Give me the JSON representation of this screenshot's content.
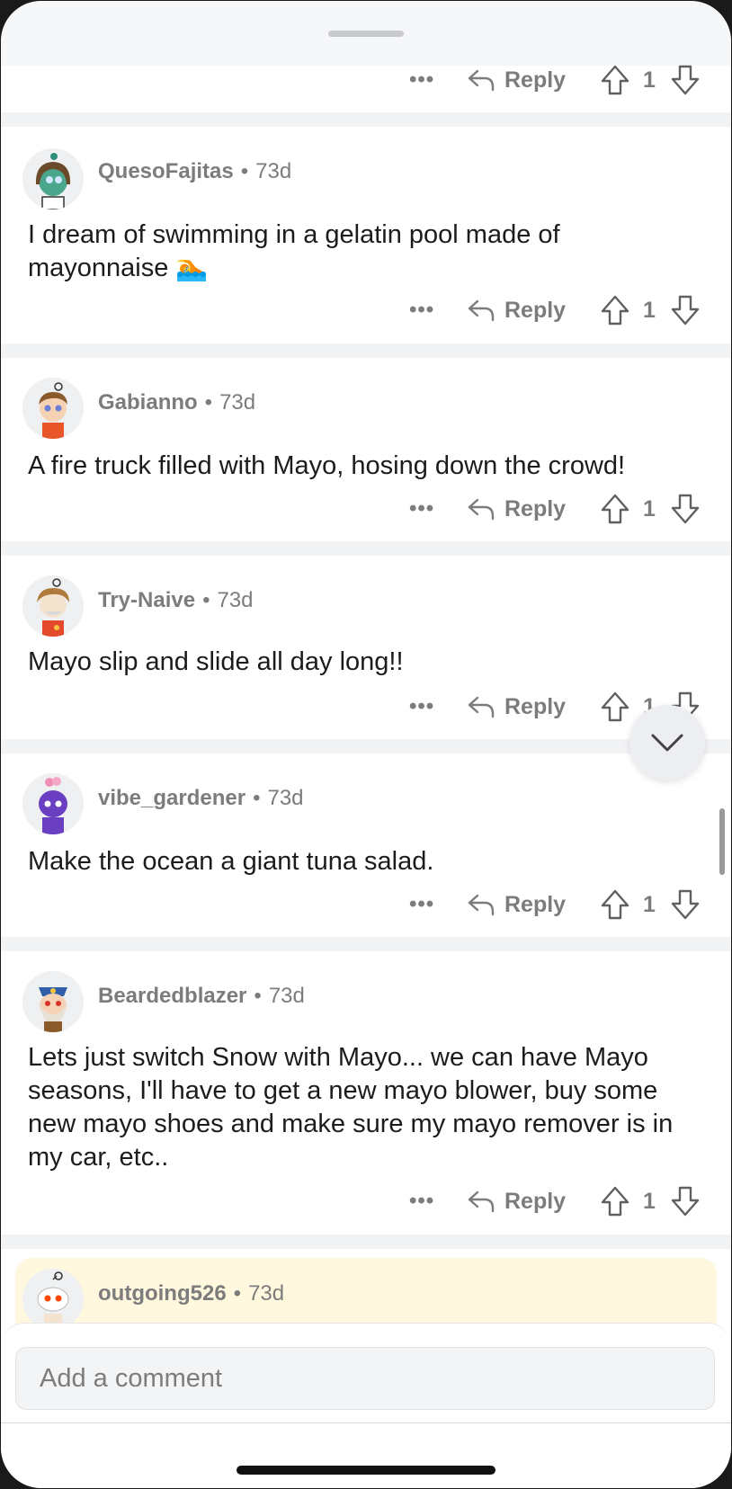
{
  "comments_top": {
    "more_label": "•••",
    "reply_label": "Reply",
    "score": "1"
  },
  "comments": [
    {
      "author": "QuesoFajitas",
      "age": "73d",
      "text": "I dream of swimming in a gelatin pool made of mayonnaise 🏊",
      "more_label": "•••",
      "reply_label": "Reply",
      "score": "1"
    },
    {
      "author": "Gabianno",
      "age": "73d",
      "text": "A fire truck filled with Mayo, hosing down the crowd!",
      "more_label": "•••",
      "reply_label": "Reply",
      "score": "1"
    },
    {
      "author": "Try-Naive",
      "age": "73d",
      "text": "Mayo slip and slide all day long!!",
      "more_label": "•••",
      "reply_label": "Reply",
      "score": "1"
    },
    {
      "author": "vibe_gardener",
      "age": "73d",
      "text": "Make the ocean a giant tuna salad.",
      "more_label": "•••",
      "reply_label": "Reply",
      "score": "1"
    },
    {
      "author": "Beardedblazer",
      "age": "73d",
      "text": "Lets just switch Snow with Mayo... we can have Mayo seasons, I'll have to get a new mayo blower, buy some new mayo shoes and make sure my mayo remover is in my car, etc..",
      "more_label": "•••",
      "reply_label": "Reply",
      "score": "1"
    },
    {
      "author": "outgoing526",
      "age": "73d"
    }
  ],
  "composer": {
    "placeholder": "Add a comment"
  },
  "colors": {
    "highlight": "#fff8df",
    "meta_gray": "#7c7c7c",
    "separator": "#f2f3f5"
  }
}
